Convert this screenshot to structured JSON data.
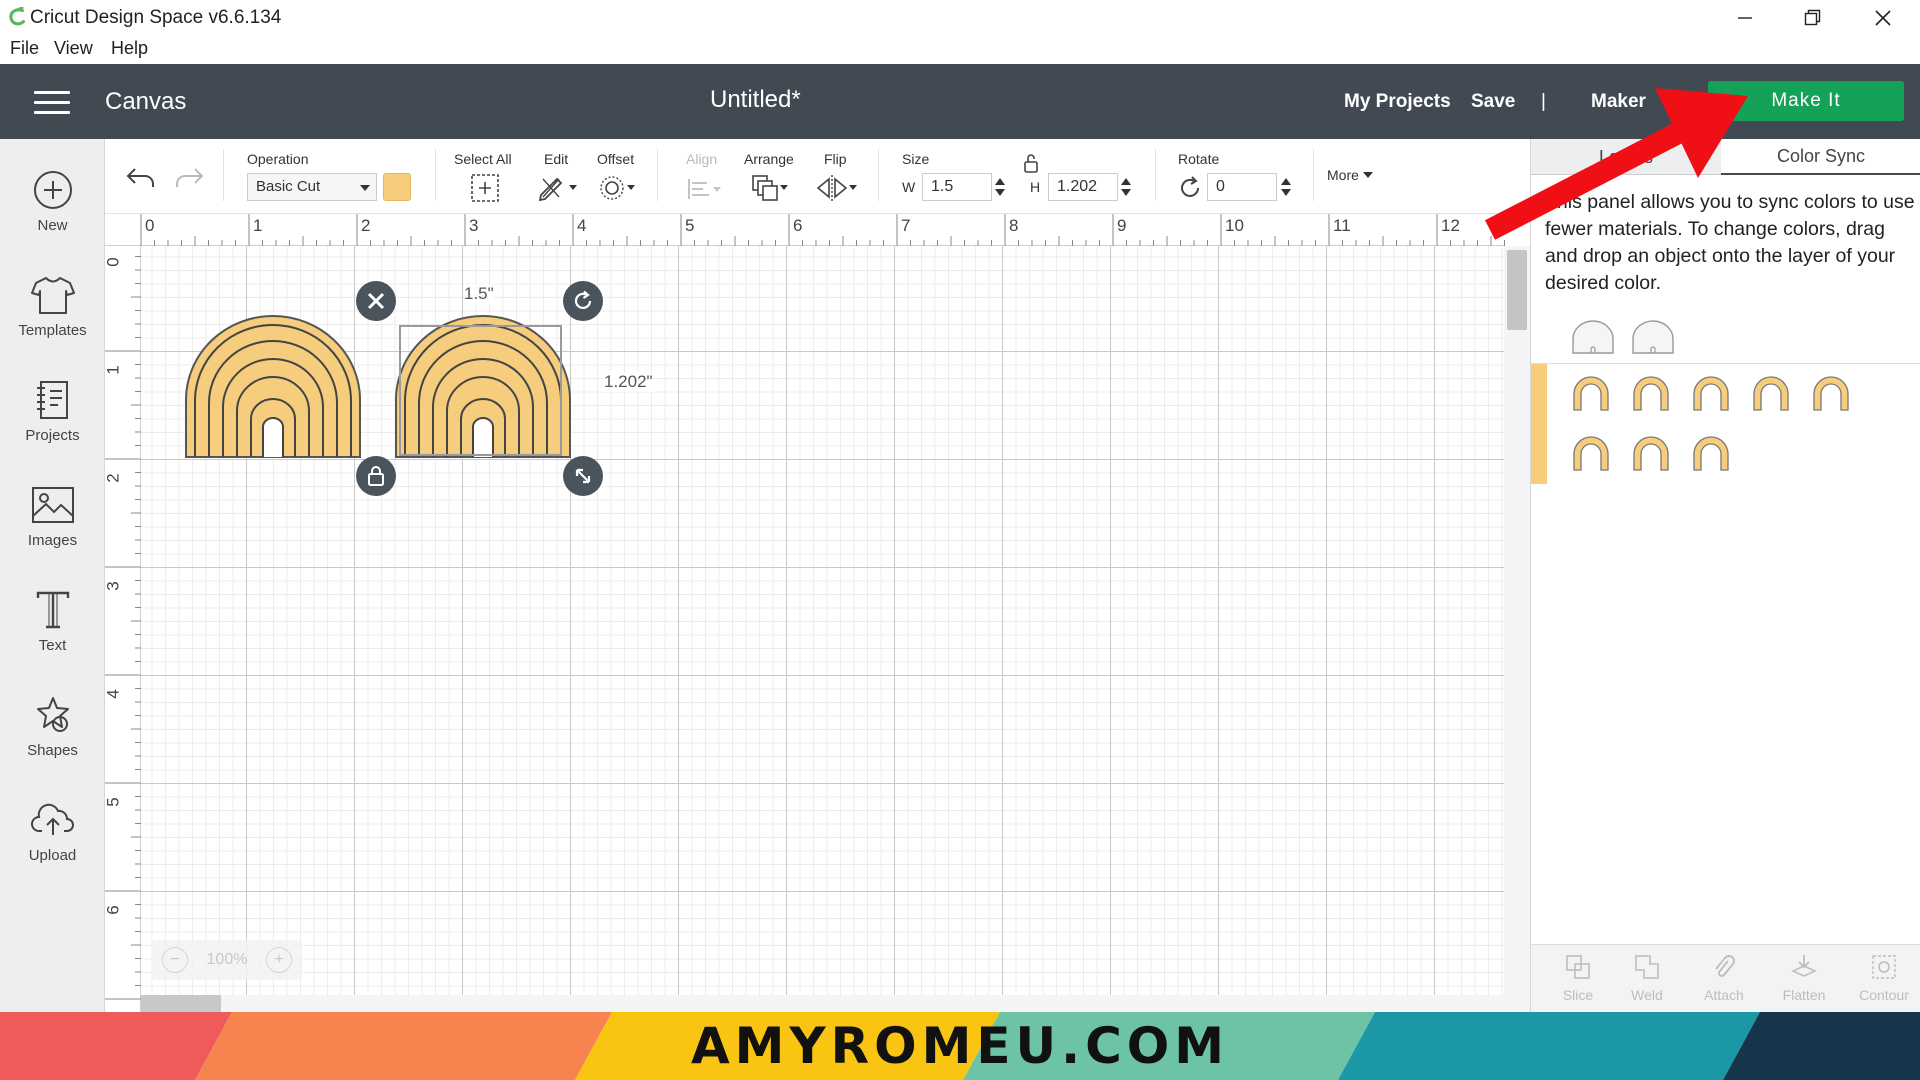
{
  "window": {
    "title": "Cricut Design Space  v6.6.134"
  },
  "menu": {
    "file": "File",
    "view": "View",
    "help": "Help"
  },
  "header": {
    "section": "Canvas",
    "doc_title": "Untitled*",
    "my_projects": "My Projects",
    "save": "Save",
    "divider": "|",
    "machine": "Maker",
    "make_it": "Make It"
  },
  "sidebar": {
    "new": "New",
    "templates": "Templates",
    "projects": "Projects",
    "images": "Images",
    "text": "Text",
    "shapes": "Shapes",
    "upload": "Upload"
  },
  "toolbar": {
    "operation_label": "Operation",
    "operation_value": "Basic Cut",
    "color": "#f5cd7d",
    "select_all": "Select All",
    "edit": "Edit",
    "offset": "Offset",
    "align": "Align",
    "arrange": "Arrange",
    "flip": "Flip",
    "size": "Size",
    "w_label": "W",
    "w_value": "1.5",
    "h_label": "H",
    "h_value": "1.202",
    "rotate": "Rotate",
    "rotate_value": "0",
    "more": "More"
  },
  "ruler": {
    "h": [
      "0",
      "1",
      "2",
      "3",
      "4",
      "5",
      "6",
      "7",
      "8",
      "9",
      "10",
      "11",
      "12"
    ],
    "v": [
      "0",
      "1",
      "2",
      "3",
      "4",
      "5",
      "6"
    ]
  },
  "canvas": {
    "width_label": "1.5\"",
    "height_label": "1.202\"",
    "zoom": "100%"
  },
  "panel": {
    "tab_layers": "Layers",
    "tab_color_sync": "Color Sync",
    "description": "This panel allows you to sync colors to use fewer materials. To change colors, drag and drop an object onto the layer of your desired color.",
    "swatch_color": "#f5cd7d",
    "actions": {
      "slice": "Slice",
      "weld": "Weld",
      "attach": "Attach",
      "flatten": "Flatten",
      "contour": "Contour"
    }
  },
  "banner": {
    "text": "AMYROMEU.COM",
    "colors": [
      "#ef5a5a",
      "#f7844f",
      "#f9c412",
      "#6cc4a4",
      "#1b97a6",
      "#17354a"
    ]
  },
  "annotation": {
    "arrow_color": "#f10f16"
  }
}
